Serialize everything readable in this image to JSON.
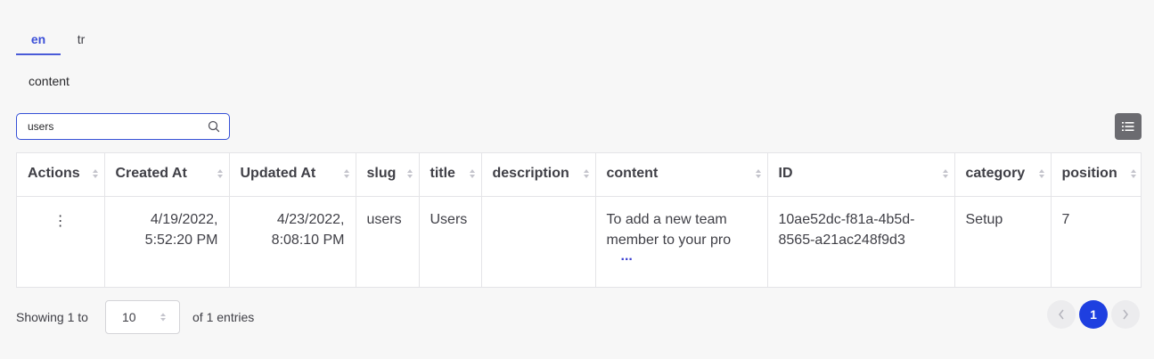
{
  "tabs": [
    {
      "label": "en",
      "active": true
    },
    {
      "label": "tr",
      "active": false
    }
  ],
  "subtab": {
    "label": "content"
  },
  "search": {
    "value": "users"
  },
  "table": {
    "columns": [
      "Actions",
      "Created At",
      "Updated At",
      "slug",
      "title",
      "description",
      "content",
      "ID",
      "category",
      "position"
    ],
    "rows": [
      {
        "actions": "⋮",
        "created_at": "4/19/2022, 5:52:20 PM",
        "updated_at": "4/23/2022, 8:08:10 PM",
        "slug": "users",
        "title": "Users",
        "description": "",
        "content": "To add a new team member to your pro",
        "content_more": "...",
        "id": "10ae52dc-f81a-4b5d-8565-a21ac248f9d3",
        "category": "Setup",
        "position": "7"
      }
    ]
  },
  "footer": {
    "showing_prefix": "Showing 1 to",
    "page_size": "10",
    "entries_suffix": "of 1 entries",
    "pages": [
      "1"
    ],
    "current_page": "1"
  },
  "icons": {
    "search": "search-icon",
    "list": "list-icon",
    "sort": "sort-icon",
    "kebab": "kebab-icon",
    "prev": "chevron-left-icon",
    "next": "chevron-right-icon"
  },
  "colors": {
    "accent": "#1e3fe0",
    "tab_active": "#3b4fd8"
  }
}
